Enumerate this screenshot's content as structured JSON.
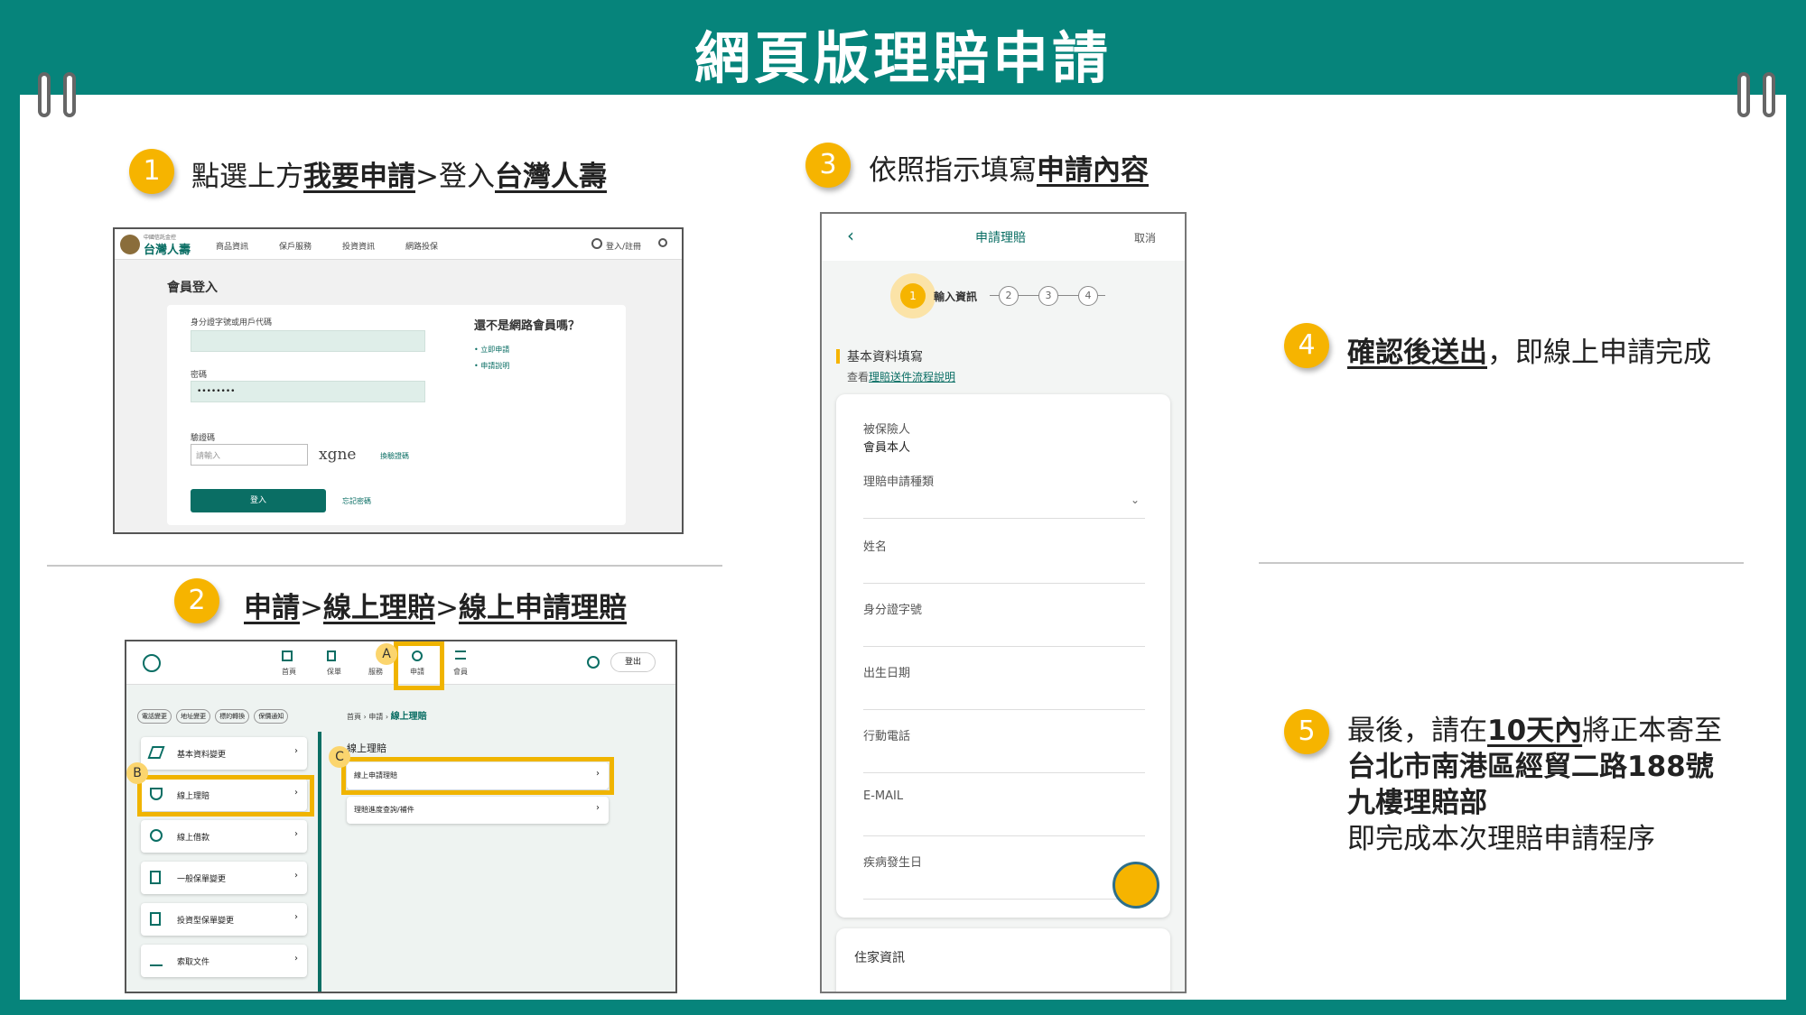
{
  "title": "網頁版理賠申請",
  "colors": {
    "teal": "#06847b",
    "badge": "#f6b400",
    "highlight": "#f0b400"
  },
  "steps": [
    {
      "num": "1",
      "pre": "點選上方",
      "b1": "我要申請",
      "mid": ">登入",
      "b2": "台灣人壽"
    },
    {
      "num": "2",
      "b1": "申請",
      "mid1": ">",
      "b2": "線上理賠",
      "mid2": ">",
      "b3": "線上申請理賠"
    },
    {
      "num": "3",
      "pre": "依照指示填寫",
      "b1": "申請內容"
    },
    {
      "num": "4",
      "b1": "確認後送出",
      "post": "，即線上申請完成"
    },
    {
      "num": "5",
      "l1pre": "最後，請在",
      "l1b": "10天內",
      "l1post": "將正本寄至",
      "l2": "台北市南港區經貿二路188號",
      "l3": "九樓理賠部",
      "l4": "即完成本次理賠申請程序"
    }
  ],
  "shot1": {
    "logo_small": "中國信託金控",
    "logo": "台灣人壽",
    "nav": [
      "商品資訊",
      "保戶服務",
      "投資資訊",
      "網路投保"
    ],
    "login_link": "登入/註冊",
    "heading": "會員登入",
    "id_label": "身分證字號或用戶代碼",
    "pw_label": "密碼",
    "pw_value": "••••••••",
    "captcha_label": "驗證碼",
    "captcha_placeholder": "請輸入",
    "captcha_text": "xgne",
    "captcha_refresh": "換驗證碼",
    "login_button": "登入",
    "forgot": "忘記密碼",
    "side_title": "還不是網路會員嗎？",
    "side_links": [
      "立即申請",
      "申請說明"
    ]
  },
  "shot2": {
    "nav": [
      "首頁",
      "保單",
      "服務",
      "申請",
      "會員"
    ],
    "logout": "登出",
    "chips": [
      "電話變更",
      "地址變更",
      "標的轉換",
      "保價通知"
    ],
    "breadcrumb": [
      "首頁",
      "申請",
      "線上理賠"
    ],
    "section": "線上理賠",
    "menu": [
      "基本資料變更",
      "線上理賠",
      "線上借款",
      "一般保單變更",
      "投資型保單變更",
      "索取文件"
    ],
    "submenu": [
      "線上申請理賠",
      "理賠進度查詢/補件"
    ],
    "labels": [
      "A",
      "B",
      "C"
    ]
  },
  "shot3": {
    "header": "申請理賠",
    "cancel": "取消",
    "progress": [
      "1",
      "輸入資訊",
      "2",
      "3",
      "4"
    ],
    "section": "基本資料填寫",
    "note_pre": "查看",
    "note_link": "理賠送件流程說明",
    "insured_label": "被保險人",
    "insured_value": "會員本人",
    "fields": [
      "理賠申請種類",
      "姓名",
      "身分證字號",
      "出生日期",
      "行動電話",
      "E-MAIL",
      "疾病發生日"
    ],
    "home": "住家資訊"
  }
}
